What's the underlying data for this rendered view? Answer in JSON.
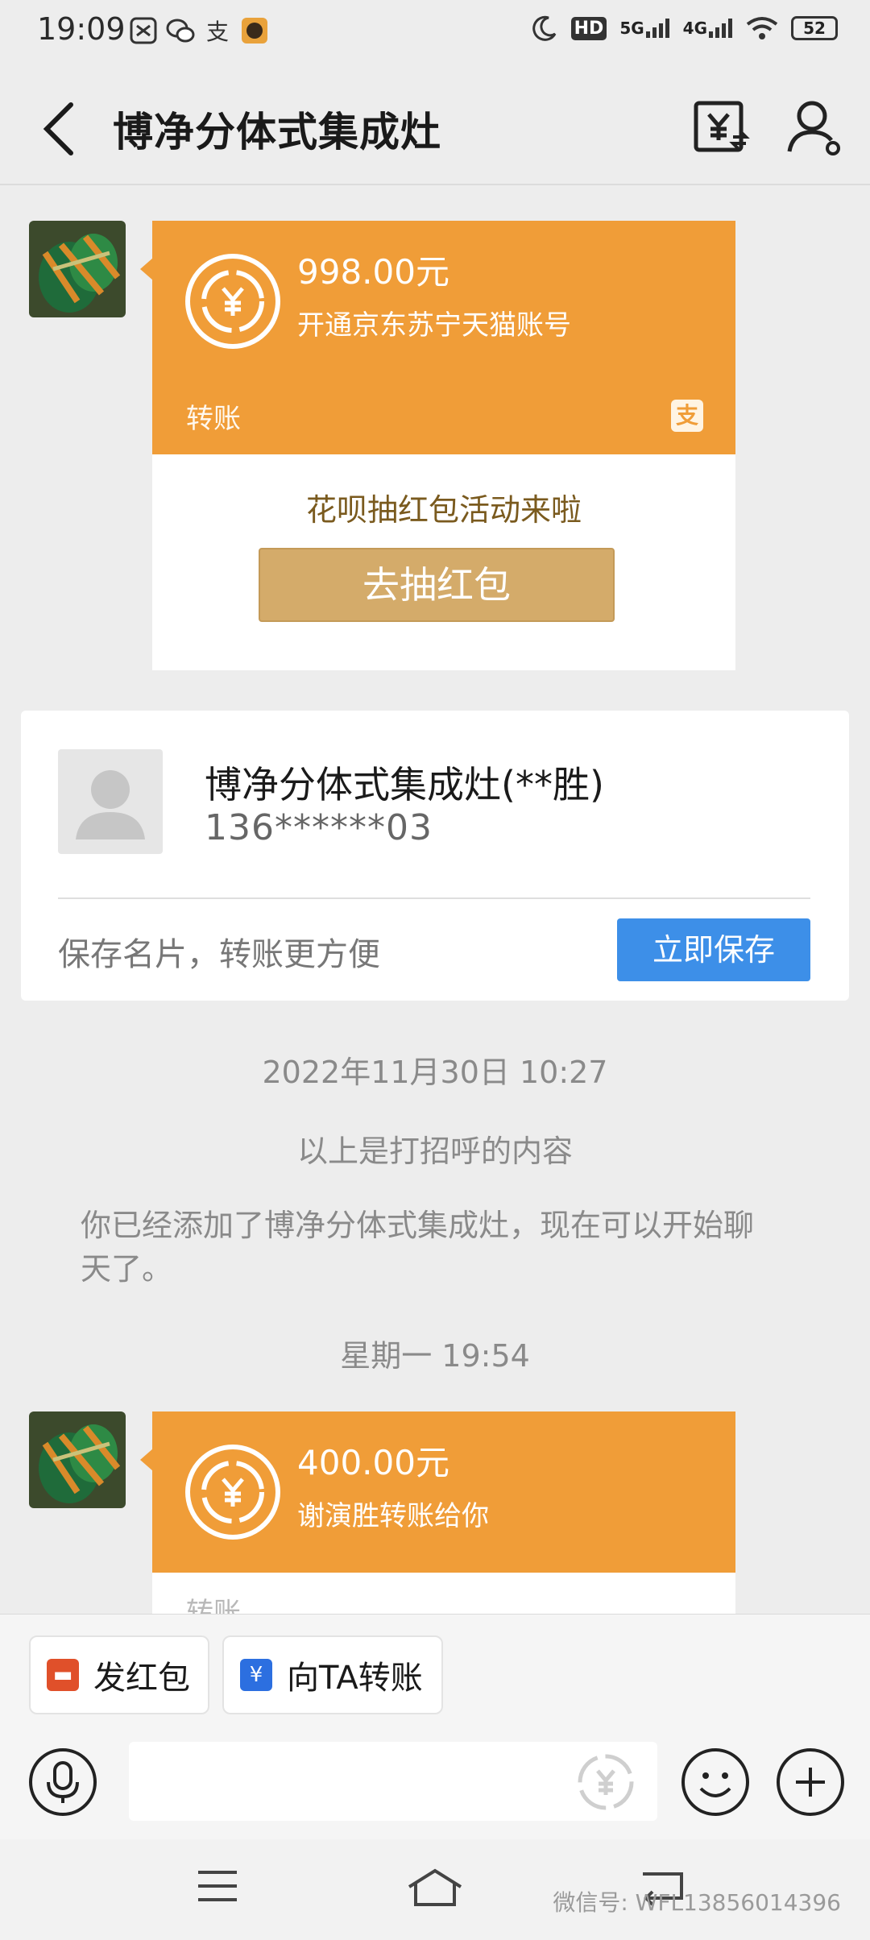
{
  "status_bar": {
    "time": "19:09",
    "battery": "52",
    "net1": "5G",
    "net2": "4G",
    "hd": "HD"
  },
  "header": {
    "title": "博净分体式集成灶"
  },
  "transfer1": {
    "amount": "998.00元",
    "note": "开通京东苏宁天猫账号",
    "label": "转账",
    "alipay_glyph": "支",
    "promo_text": "花呗抽红包活动来啦",
    "promo_button": "去抽红包"
  },
  "contact_card": {
    "name": "博净分体式集成灶(**胜)",
    "phone": "136******03",
    "hint": "保存名片，转账更方便",
    "save_button": "立即保存"
  },
  "system": {
    "timestamp1": "2022年11月30日  10:27",
    "greeting": "以上是打招呼的内容",
    "added": "你已经添加了博净分体式集成灶，现在可以开始聊天了。",
    "timestamp2": "星期一  19:54"
  },
  "transfer2": {
    "amount": "400.00元",
    "note": "谢演胜转账给你",
    "label": "转账"
  },
  "quick_actions": [
    {
      "label": "发红包",
      "icon": "red-packet-icon",
      "color": "#e0502a"
    },
    {
      "label": "向TA转账",
      "icon": "transfer-icon",
      "color": "#2c6fe0"
    }
  ],
  "watermark": "微信号: WFL13856014396",
  "colors": {
    "orange": "#f09d38",
    "gold_button": "#d4ab6a",
    "blue_button": "#3d8fe8"
  }
}
